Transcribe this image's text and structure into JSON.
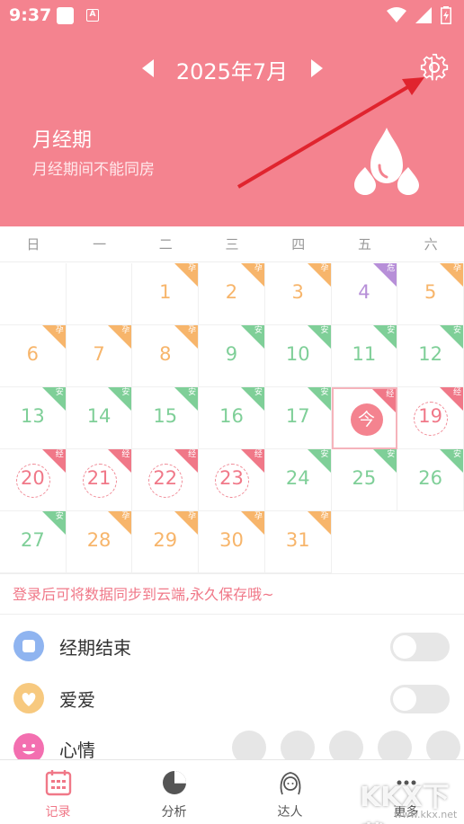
{
  "status": {
    "time": "9:37",
    "a_icon": "A"
  },
  "header": {
    "month_title": "2025年7月",
    "phase_title": "月经期",
    "phase_subtitle": "月经期间不能同房",
    "bg_color": "#f4838f"
  },
  "weekdays": [
    "日",
    "一",
    "二",
    "三",
    "四",
    "五",
    "六"
  ],
  "tags": {
    "preg": "孕",
    "safe": "安",
    "danger": "危",
    "period": "经"
  },
  "calendar": {
    "today_label": "今",
    "days": [
      {
        "d": "1",
        "t": "preg"
      },
      {
        "d": "2",
        "t": "preg"
      },
      {
        "d": "3",
        "t": "preg"
      },
      {
        "d": "4",
        "t": "danger"
      },
      {
        "d": "5",
        "t": "preg"
      },
      {
        "d": "6",
        "t": "preg"
      },
      {
        "d": "7",
        "t": "preg"
      },
      {
        "d": "8",
        "t": "preg"
      },
      {
        "d": "9",
        "t": "safe"
      },
      {
        "d": "10",
        "t": "safe"
      },
      {
        "d": "11",
        "t": "safe"
      },
      {
        "d": "12",
        "t": "safe"
      },
      {
        "d": "13",
        "t": "safe"
      },
      {
        "d": "14",
        "t": "safe"
      },
      {
        "d": "15",
        "t": "safe"
      },
      {
        "d": "16",
        "t": "safe"
      },
      {
        "d": "17",
        "t": "safe"
      },
      {
        "d": "18",
        "t": "period",
        "today": true
      },
      {
        "d": "19",
        "t": "period"
      },
      {
        "d": "20",
        "t": "period"
      },
      {
        "d": "21",
        "t": "period"
      },
      {
        "d": "22",
        "t": "period"
      },
      {
        "d": "23",
        "t": "period"
      },
      {
        "d": "24",
        "t": "safe"
      },
      {
        "d": "25",
        "t": "safe"
      },
      {
        "d": "26",
        "t": "safe"
      },
      {
        "d": "27",
        "t": "safe"
      },
      {
        "d": "28",
        "t": "preg"
      },
      {
        "d": "29",
        "t": "preg"
      },
      {
        "d": "30",
        "t": "preg"
      },
      {
        "d": "31",
        "t": "preg"
      }
    ],
    "first_weekday": 2
  },
  "colors": {
    "preg": "#f7b56b",
    "safe": "#7fcf98",
    "period": "#f07888",
    "danger": "#b78fd8"
  },
  "notice": "登录后可将数据同步到云端,永久保存哦~",
  "rows": {
    "period_end": "经期结束",
    "love": "爱爱",
    "mood": "心情"
  },
  "tabs": [
    {
      "label": "记录",
      "icon": "calendar-icon"
    },
    {
      "label": "分析",
      "icon": "pie-chart-icon"
    },
    {
      "label": "达人",
      "icon": "girl-avatar-icon"
    },
    {
      "label": "更多",
      "icon": "more-icon"
    }
  ],
  "watermark": {
    "brand": "KKX下载",
    "url": "www.kkx.net"
  }
}
